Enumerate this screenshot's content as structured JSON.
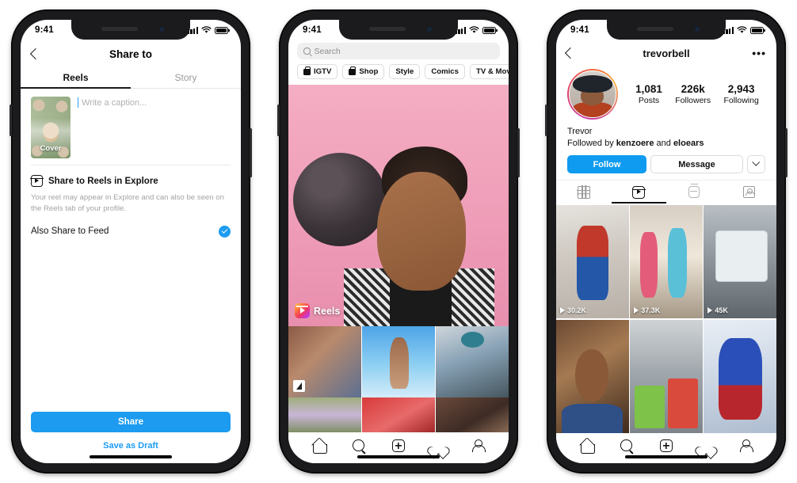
{
  "phones": [
    {
      "id": "share-to",
      "status": {
        "time": "9:41"
      },
      "nav": {
        "back_icon": "chevron-left-icon",
        "title": "Share to",
        "menu_icon": ""
      },
      "tabs": [
        {
          "label": "Reels",
          "active": true
        },
        {
          "label": "Story",
          "active": false
        }
      ],
      "composer": {
        "cover_label": "Cover",
        "caption_placeholder": "Write a caption..."
      },
      "options": {
        "explore_title": "Share to Reels in Explore",
        "explore_icon": "reels-icon",
        "explore_description": "Your reel may appear in Explore and can also be seen on the Reels tab of your profile.",
        "feed_label": "Also Share to Feed",
        "feed_checked": true,
        "check_color": "#1d9bf0"
      },
      "footer": {
        "share_label": "Share",
        "draft_label": "Save as Draft",
        "share_bg": "#1d9bf0",
        "draft_color": "#1d9bf0"
      }
    },
    {
      "id": "explore",
      "status": {
        "time": "9:41"
      },
      "search": {
        "placeholder": "Search",
        "icon": "search-icon"
      },
      "chips": [
        {
          "label": "IGTV",
          "icon": "igtv-icon"
        },
        {
          "label": "Shop",
          "icon": "shop-bag-icon"
        },
        {
          "label": "Style",
          "icon": ""
        },
        {
          "label": "Comics",
          "icon": ""
        },
        {
          "label": "TV & Movie",
          "icon": ""
        }
      ],
      "hero": {
        "badge_label": "Reels",
        "badge_icon": "reels-gradient-icon"
      },
      "nav": [
        {
          "name": "home",
          "icon": "home-icon"
        },
        {
          "name": "search",
          "icon": "search-icon"
        },
        {
          "name": "add",
          "icon": "plus-square-icon"
        },
        {
          "name": "activity",
          "icon": "heart-icon"
        },
        {
          "name": "profile",
          "icon": "person-icon"
        }
      ]
    },
    {
      "id": "profile",
      "status": {
        "time": "9:41"
      },
      "nav": {
        "back_icon": "chevron-left-icon",
        "title": "trevorbell",
        "menu_icon": "more-options-icon",
        "menu_glyph": "•••"
      },
      "stats": [
        {
          "value": "1,081",
          "label": "Posts"
        },
        {
          "value": "226k",
          "label": "Followers"
        },
        {
          "value": "2,943",
          "label": "Following"
        }
      ],
      "bio": {
        "name": "Trevor",
        "followed_prefix": "Followed by ",
        "followed_user_1": "kenzoere",
        "followed_joiner": " and ",
        "followed_user_2": "eloears"
      },
      "actions": {
        "follow_label": "Follow",
        "message_label": "Message",
        "caret_icon": "chevron-down-icon",
        "follow_bg": "#0f9bf0"
      },
      "tabs": [
        {
          "name": "grid",
          "icon": "grid-icon",
          "active": false
        },
        {
          "name": "reels",
          "icon": "reels-icon",
          "active": true
        },
        {
          "name": "igtv",
          "icon": "igtv-icon",
          "active": false
        },
        {
          "name": "tagged",
          "icon": "tagged-icon",
          "active": false
        }
      ],
      "reels": [
        [
          {
            "views": "30.2K",
            "play_icon": "play-icon"
          },
          {
            "views": "37.3K",
            "play_icon": "play-icon"
          },
          {
            "views": "45K",
            "play_icon": "play-icon"
          }
        ],
        [
          {
            "views": "",
            "play_icon": ""
          },
          {
            "views": "",
            "play_icon": ""
          },
          {
            "views": "",
            "play_icon": ""
          }
        ]
      ]
    }
  ]
}
